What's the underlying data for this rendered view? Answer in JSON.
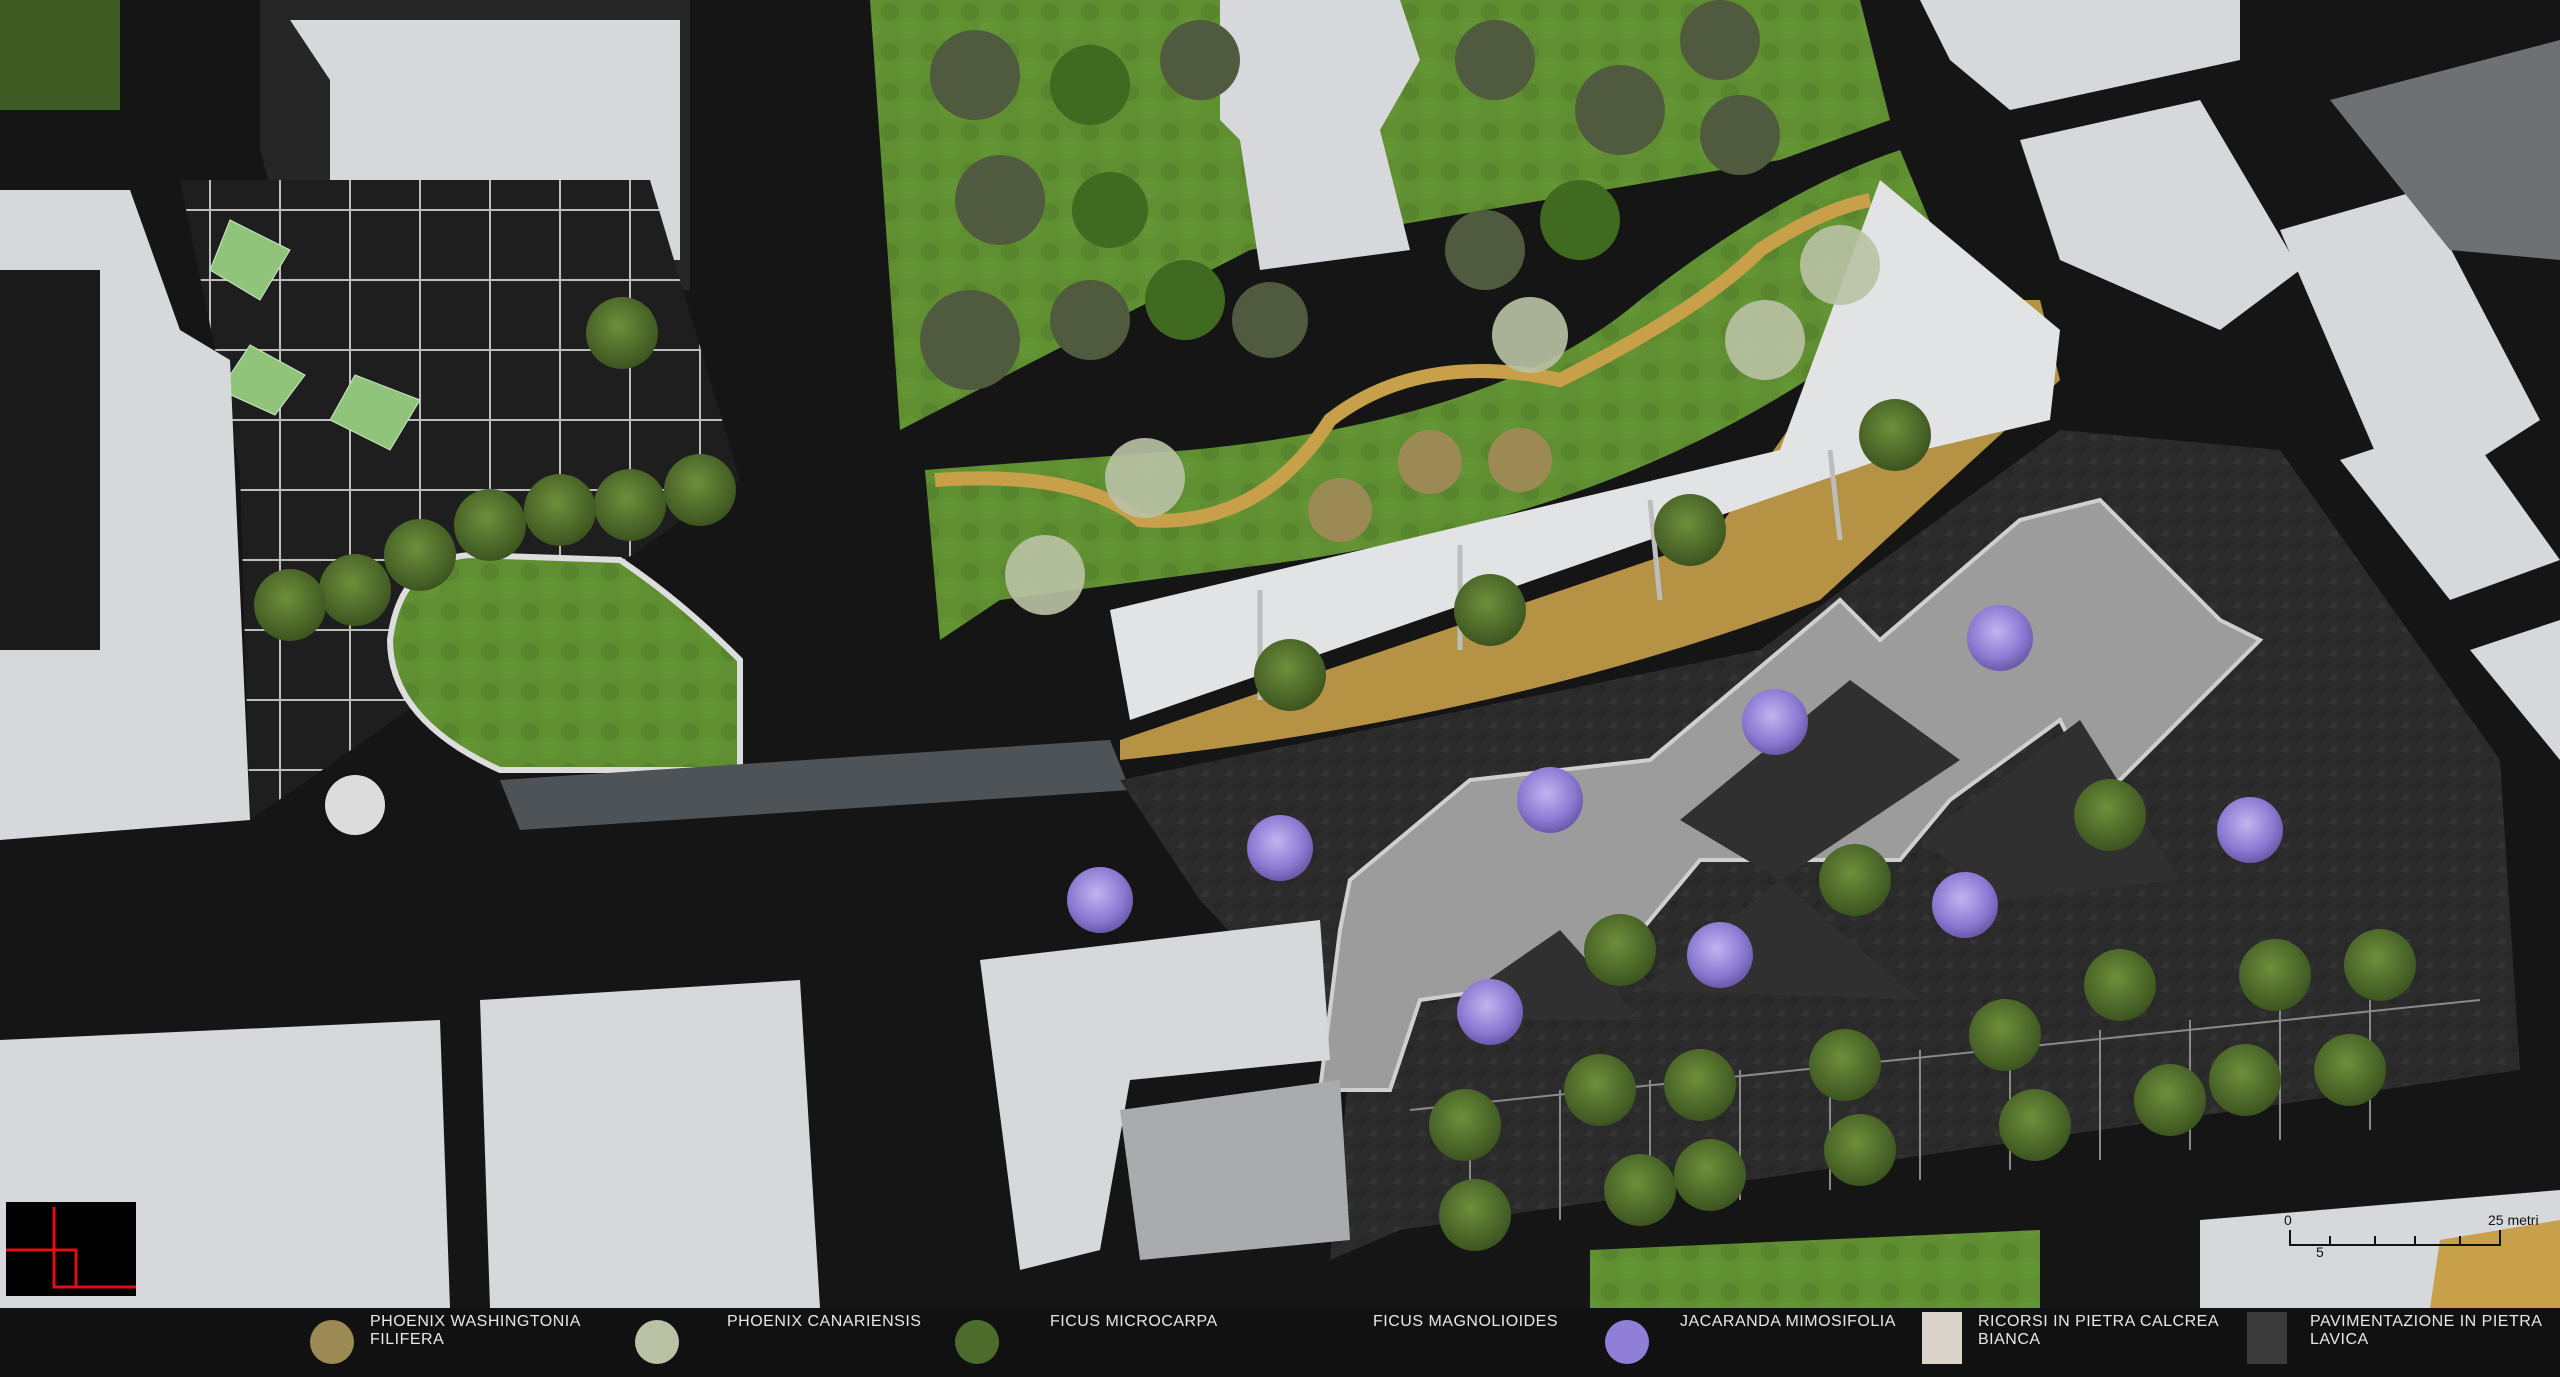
{
  "legend": {
    "items": [
      {
        "label": "PHOENIX WASHINGTONIA\nFILIFERA",
        "icon": "phoenix-washingtonia-icon"
      },
      {
        "label": "PHOENIX CANARIENSIS",
        "icon": "phoenix-canariensis-icon"
      },
      {
        "label": "FICUS MICROCARPA",
        "icon": "ficus-microcarpa-icon"
      },
      {
        "label": "FICUS MAGNOLIOIDES",
        "icon": "ficus-magnolioides-icon"
      },
      {
        "label": "JACARANDA MIMOSIFOLIA",
        "icon": "jacaranda-icon"
      },
      {
        "label": "RICORSI IN PIETRA CALCREA\nBIANCA",
        "icon": "white-limestone-swatch"
      },
      {
        "label": "PAVIMENTAZIONE IN PIETRA\nLAVICA",
        "icon": "lava-stone-swatch"
      }
    ]
  },
  "scale": {
    "start": "0",
    "mid": "5",
    "end": "25 metri"
  },
  "colors": {
    "road": "#141414",
    "building": "#d6d8db",
    "lawn": "#5b8a2e",
    "path": "#c8a04a",
    "plaza": "#9a9a9a",
    "lava": "#2a2a2a",
    "jacaranda": "#8f7fd6",
    "tree": "#4d6b2a"
  }
}
